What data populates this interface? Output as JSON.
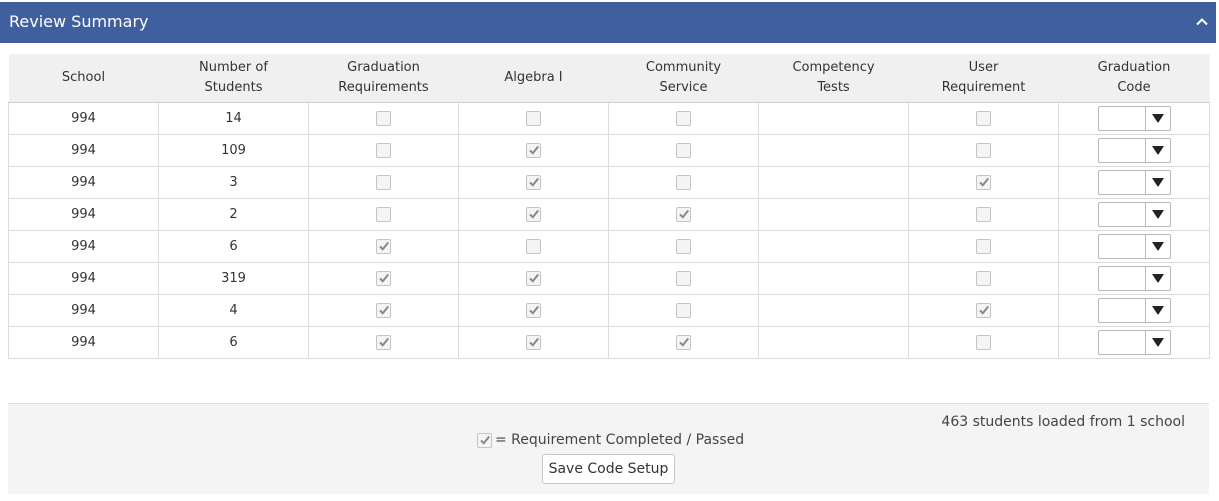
{
  "header": {
    "title": "Review Summary",
    "collapse_icon": "chevron-up-icon"
  },
  "table": {
    "columns": [
      {
        "line1": "School",
        "line2": ""
      },
      {
        "line1": "Number of",
        "line2": "Students"
      },
      {
        "line1": "Graduation",
        "line2": "Requirements"
      },
      {
        "line1": "Algebra I",
        "line2": ""
      },
      {
        "line1": "Community",
        "line2": "Service"
      },
      {
        "line1": "Competency",
        "line2": "Tests"
      },
      {
        "line1": "User",
        "line2": "Requirement"
      },
      {
        "line1": "Graduation",
        "line2": "Code"
      }
    ],
    "rows": [
      {
        "school": "994",
        "students": "14",
        "grad_req": false,
        "algebra": false,
        "community": false,
        "user_req": false,
        "code": ""
      },
      {
        "school": "994",
        "students": "109",
        "grad_req": false,
        "algebra": true,
        "community": false,
        "user_req": false,
        "code": ""
      },
      {
        "school": "994",
        "students": "3",
        "grad_req": false,
        "algebra": true,
        "community": false,
        "user_req": true,
        "code": ""
      },
      {
        "school": "994",
        "students": "2",
        "grad_req": false,
        "algebra": true,
        "community": true,
        "user_req": false,
        "code": ""
      },
      {
        "school": "994",
        "students": "6",
        "grad_req": true,
        "algebra": false,
        "community": false,
        "user_req": false,
        "code": ""
      },
      {
        "school": "994",
        "students": "319",
        "grad_req": true,
        "algebra": true,
        "community": false,
        "user_req": false,
        "code": ""
      },
      {
        "school": "994",
        "students": "4",
        "grad_req": true,
        "algebra": true,
        "community": false,
        "user_req": true,
        "code": ""
      },
      {
        "school": "994",
        "students": "6",
        "grad_req": true,
        "algebra": true,
        "community": true,
        "user_req": false,
        "code": ""
      }
    ]
  },
  "footer": {
    "loaded_text": "463 students loaded from 1 school",
    "legend_text": "= Requirement Completed / Passed",
    "save_label": "Save Code Setup"
  }
}
